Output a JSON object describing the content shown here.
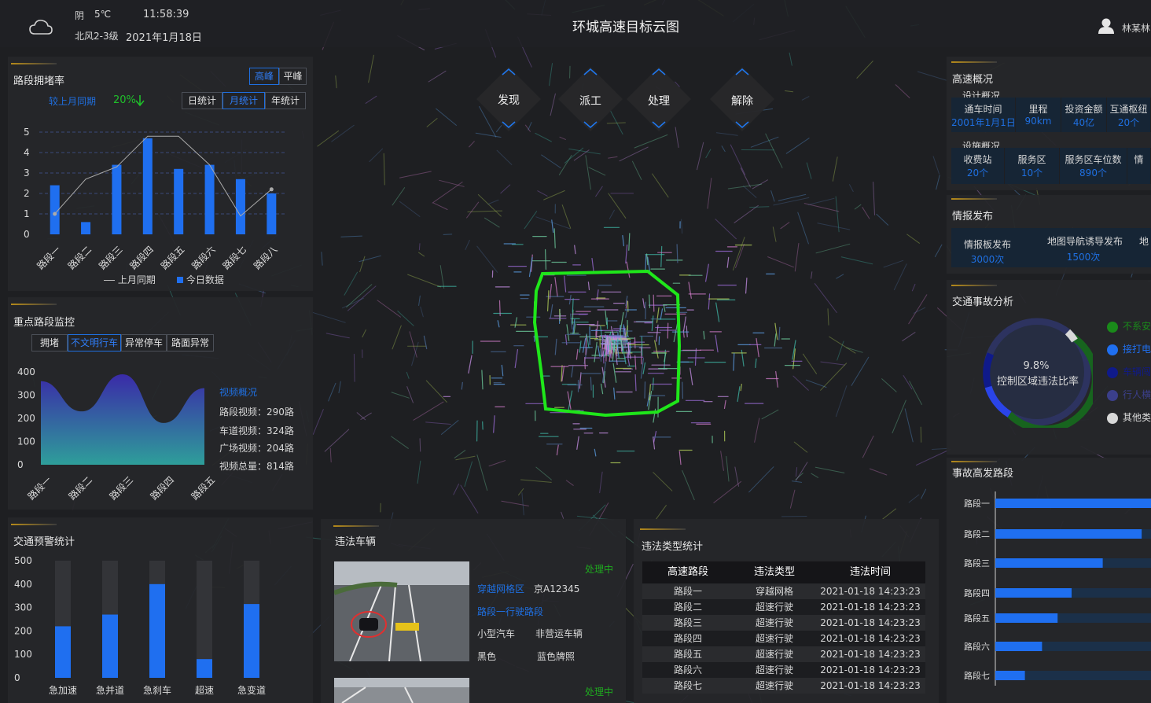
{
  "header": {
    "weather": "阴",
    "temperature": "5℃",
    "time": "11:58:39",
    "wind": "北风2-3级",
    "date": "2021年1月18日",
    "title": "环城高速目标云图",
    "user": "林某林"
  },
  "actions": {
    "discover": "发现",
    "dispatch": "派工",
    "handle": "处理",
    "release": "解除"
  },
  "congestion": {
    "title": "路段拥堵率",
    "peak": "高峰",
    "offpeak": "平峰",
    "compare_label": "较上月同期",
    "compare_value": "20%",
    "day": "日统计",
    "month": "月统计",
    "year": "年统计",
    "legend_last": "上月同期",
    "legend_today": "今日数据"
  },
  "monitor": {
    "title": "重点路段监控",
    "tabs": [
      "拥堵",
      "不文明行车",
      "异常停车",
      "路面异常"
    ],
    "video_title": "视频概况",
    "road_video": "路段视频：290路",
    "lane_video": "车道视频：324路",
    "square_video": "广场视频：204路",
    "total_video": "视频总量：814路"
  },
  "alarm": {
    "title": "交通预警统计"
  },
  "violation_vehicle": {
    "title": "违法车辆",
    "status1": "处理中",
    "status2": "处理中",
    "type1": "穿越网格区",
    "plate": "京A12345",
    "type2": "路段一行驶路段",
    "car_type": "小型汽车",
    "usage": "非营运车辆",
    "color": "黑色",
    "plate_color": "蓝色牌照",
    "cam_text": "处理中"
  },
  "violation_stats": {
    "title": "违法类型统计",
    "headers": [
      "高速路段",
      "违法类型",
      "违法时间"
    ],
    "rows": [
      [
        "路段一",
        "穿越网格",
        "2021-01-18 14:23:23"
      ],
      [
        "路段二",
        "超速行驶",
        "2021-01-18 14:23:23"
      ],
      [
        "路段三",
        "超速行驶",
        "2021-01-18 14:23:23"
      ],
      [
        "路段四",
        "超速行驶",
        "2021-01-18 14:23:23"
      ],
      [
        "路段五",
        "超速行驶",
        "2021-01-18 14:23:23"
      ],
      [
        "路段六",
        "超速行驶",
        "2021-01-18 14:23:23"
      ],
      [
        "路段七",
        "超速行驶",
        "2021-01-18 14:23:23"
      ]
    ]
  },
  "overview": {
    "title": "高速概况",
    "design_title": "设计概况",
    "design": [
      [
        "通车时间",
        "2001年1月1日"
      ],
      [
        "里程",
        "90km"
      ],
      [
        "投资金额",
        "40亿"
      ],
      [
        "互通枢纽",
        "20个"
      ]
    ],
    "facility_title": "设施概况",
    "facility": [
      [
        "收费站",
        "20个"
      ],
      [
        "服务区",
        "10个"
      ],
      [
        "服务区车位数",
        "890个"
      ],
      [
        "情",
        ""
      ]
    ]
  },
  "info": {
    "title": "情报发布",
    "items": [
      [
        "情报板发布",
        "3000次"
      ],
      [
        "地图导航诱导发布",
        "1500次"
      ],
      [
        "地",
        ""
      ]
    ]
  },
  "accident": {
    "title": "交通事故分析",
    "rate": "9.8%",
    "rate_label": "控制区域违法比率",
    "legend": [
      "不系安",
      "接打电",
      "车辆闯",
      "行人横",
      "其他类"
    ],
    "legend_colors": [
      "#1a8a1a",
      "#1f6ff0",
      "#0f1a8a",
      "#3b3f8a",
      "#d8d8d8"
    ],
    "hot_title": "事故高发路段"
  },
  "chart_data": [
    {
      "type": "bar",
      "title": "路段拥堵率",
      "categories": [
        "路段一",
        "路段二",
        "路段三",
        "路段四",
        "路段五",
        "路段六",
        "路段七",
        "路段八"
      ],
      "series": [
        {
          "name": "今日数据",
          "type": "bar",
          "values": [
            2.4,
            0.6,
            3.4,
            4.7,
            3.2,
            3.4,
            2.7,
            2.0
          ]
        },
        {
          "name": "上月同期",
          "type": "line",
          "values": [
            1.0,
            2.7,
            3.3,
            4.8,
            4.8,
            3.4,
            0.9,
            2.2
          ]
        }
      ],
      "ylim": [
        0,
        5
      ],
      "yticks": [
        0,
        1,
        2,
        3,
        4,
        5
      ]
    },
    {
      "type": "area",
      "title": "重点路段监控",
      "categories": [
        "路段一",
        "路段二",
        "路段三",
        "路段四",
        "路段五"
      ],
      "values": [
        360,
        230,
        390,
        180,
        330
      ],
      "ylim": [
        0,
        400
      ],
      "yticks": [
        0,
        100,
        200,
        300,
        400
      ]
    },
    {
      "type": "bar",
      "title": "交通预警统计",
      "categories": [
        "急加速",
        "急并道",
        "急刹车",
        "超速",
        "急变道"
      ],
      "values": [
        220,
        270,
        400,
        80,
        315
      ],
      "max": 500,
      "ylim": [
        0,
        500
      ],
      "yticks": [
        0,
        100,
        200,
        300,
        400,
        500
      ]
    },
    {
      "type": "bar",
      "title": "事故高发路段",
      "categories": [
        "路段一",
        "路段二",
        "路段三",
        "路段四",
        "路段五",
        "路段六",
        "路段七"
      ],
      "values": [
        100,
        94,
        69,
        49,
        40,
        30,
        19
      ],
      "max": 100
    }
  ]
}
